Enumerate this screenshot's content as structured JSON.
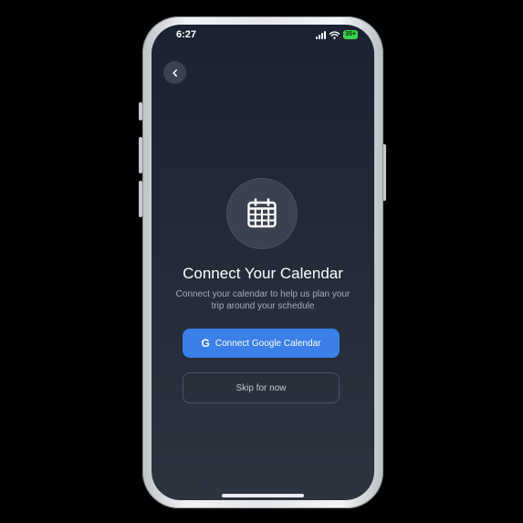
{
  "status_bar": {
    "time": "6:27",
    "battery": "35+"
  },
  "header": {
    "back_icon": "chevron-left-icon"
  },
  "hero": {
    "icon": "calendar-icon",
    "title": "Connect Your Calendar",
    "subtitle": "Connect your calendar to help us plan your trip around your schedule"
  },
  "actions": {
    "google_icon": "G",
    "google_label": "Connect Google Calendar",
    "skip_label": "Skip for now"
  },
  "colors": {
    "primary": "#3b7fe8",
    "background_top": "#1b2231",
    "background_bottom": "#2d3440",
    "battery": "#38d44a"
  }
}
